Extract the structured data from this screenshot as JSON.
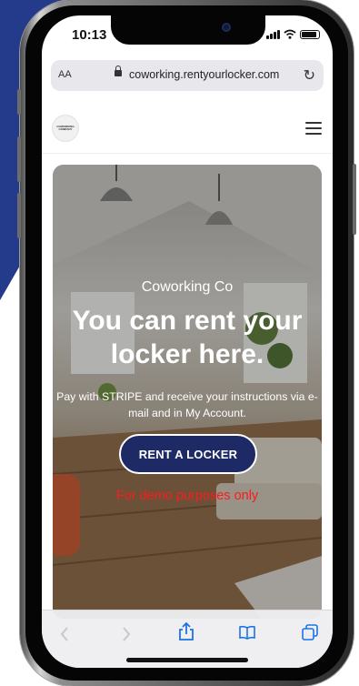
{
  "status_bar": {
    "time": "10:13"
  },
  "browser": {
    "text_size_label": "AA",
    "url": "coworking.rentyourlocker.com",
    "reload_icon": "reload-icon"
  },
  "site_header": {
    "logo_text_line1": "COWORKING",
    "logo_text_line2": "COMPANY",
    "menu_icon": "hamburger-menu-icon"
  },
  "hero": {
    "subtitle": "Coworking Co",
    "title": "You can rent your locker here.",
    "description": "Pay with STRIPE and receive your instructions via e-mail and in My Account.",
    "cta_label": "RENT A LOCKER",
    "demo_note": "For demo purposes only"
  },
  "toolbar": {
    "back_icon": "back-chevron-icon",
    "forward_icon": "forward-chevron-icon",
    "share_icon": "share-icon",
    "bookmarks_icon": "bookmarks-icon",
    "tabs_icon": "tabs-icon"
  },
  "colors": {
    "background_accent": "#243a8a",
    "cta_background": "#1e2a66",
    "demo_note": "#ff1a1a",
    "toolbar_icon": "#1a73e8"
  }
}
